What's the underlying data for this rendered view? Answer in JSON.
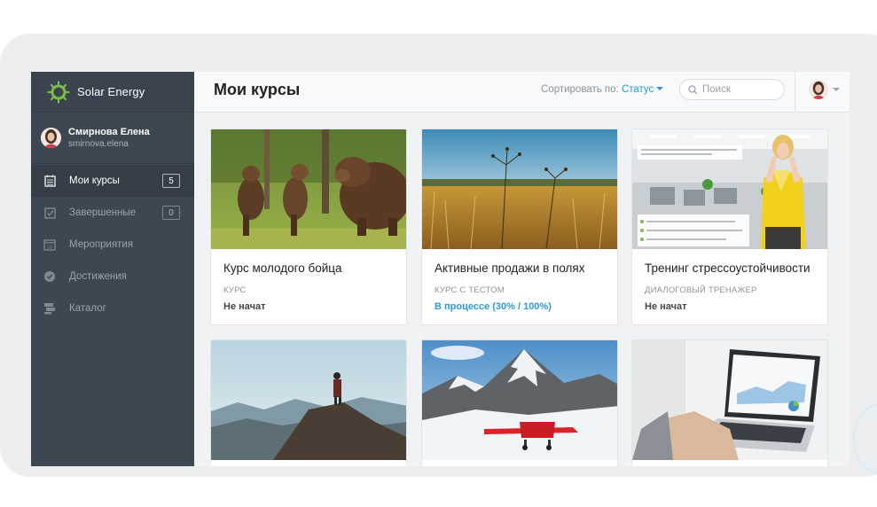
{
  "brand": {
    "name": "Solar Energy"
  },
  "user": {
    "name": "Смирнова Елена",
    "login": "smirnova.elena"
  },
  "menu": [
    {
      "label": "Мои курсы",
      "count": "5",
      "icon": "calendar-list-icon",
      "active": true
    },
    {
      "label": "Завершенные",
      "count": "0",
      "icon": "checkbox-icon",
      "active": false
    },
    {
      "label": "Мероприятия",
      "count": "",
      "icon": "calendar-15-icon",
      "active": false
    },
    {
      "label": "Достижения",
      "count": "",
      "icon": "medal-icon",
      "active": false
    },
    {
      "label": "Каталог",
      "count": "",
      "icon": "catalog-icon",
      "active": false
    }
  ],
  "topbar": {
    "title": "Мои курсы",
    "sort_label": "Сортировать по:",
    "sort_value": "Статус",
    "search_placeholder": "Поиск"
  },
  "cards": [
    {
      "title": "Курс молодого бойца",
      "type": "КУРС",
      "status": "Не начат",
      "image": "bears-photo"
    },
    {
      "title": "Активные продажи в полях",
      "type": "КУРС С ТЕСТОМ",
      "status": "В процессе (30% / 100%)",
      "image": "field-photo"
    },
    {
      "title": "Тренинг стрессоустойчивости",
      "type": "ДИАЛОГОВЫЙ ТРЕНАЖЕР",
      "status": "Не начат",
      "image": "office-stress-photo"
    },
    {
      "title": "",
      "type": "",
      "status": "",
      "image": "mountain-hiker-photo"
    },
    {
      "title": "",
      "type": "",
      "status": "",
      "image": "snow-plane-photo"
    },
    {
      "title": "",
      "type": "",
      "status": "",
      "image": "laptop-analytics-photo"
    }
  ],
  "colors": {
    "sidebar": "#3d4752",
    "accent": "#2d9ad6",
    "logo": "#7ac143"
  }
}
